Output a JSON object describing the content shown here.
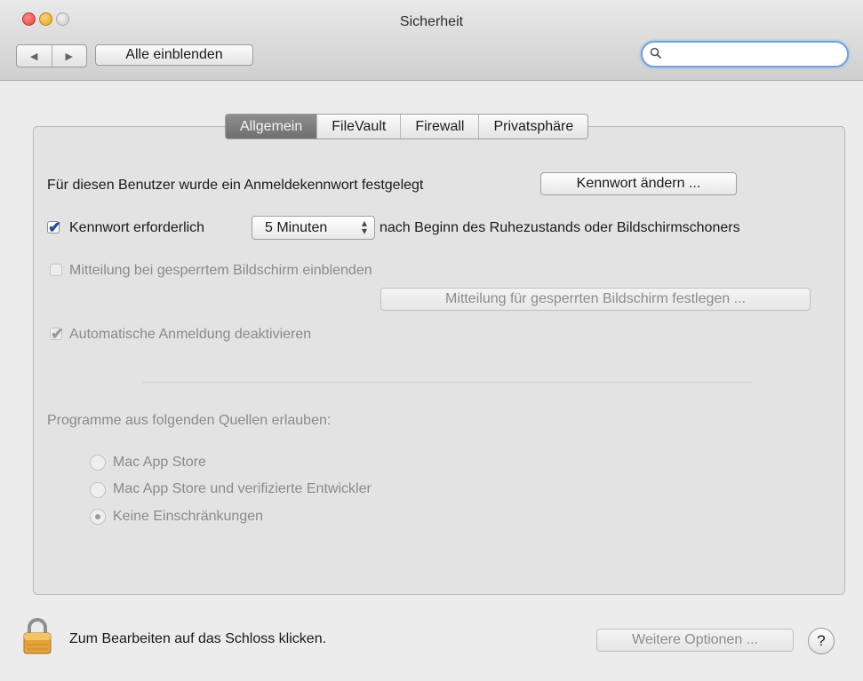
{
  "window": {
    "title": "Sicherheit"
  },
  "toolbar": {
    "back_icon": "◀",
    "forward_icon": "▶",
    "show_all_label": "Alle einblenden",
    "search_placeholder": "",
    "search_value": ""
  },
  "tabs": [
    {
      "label": "Allgemein",
      "active": true
    },
    {
      "label": "FileVault",
      "active": false
    },
    {
      "label": "Firewall",
      "active": false
    },
    {
      "label": "Privatsphäre",
      "active": false
    }
  ],
  "general": {
    "password_set_text": "Für diesen Benutzer wurde ein Anmeldekennwort festgelegt",
    "change_password_label": "Kennwort ändern ...",
    "require_password": {
      "label": "Kennwort erforderlich",
      "checked": true
    },
    "delay_select": {
      "value": "5 Minuten"
    },
    "after_sleep_text": "nach Beginn des Ruhezustands oder Bildschirmschoners",
    "show_message": {
      "label": "Mitteilung bei gesperrtem Bildschirm einblenden",
      "checked": false,
      "enabled": false
    },
    "set_message_label": "Mitteilung für gesperrten Bildschirm festlegen ...",
    "disable_auto_login": {
      "label": "Automatische Anmeldung deaktivieren",
      "checked": true,
      "enabled": false
    }
  },
  "gatekeeper": {
    "heading": "Programme aus folgenden Quellen erlauben:",
    "options": [
      {
        "label": "Mac App Store",
        "selected": false
      },
      {
        "label": "Mac App Store und verifizierte Entwickler",
        "selected": false
      },
      {
        "label": "Keine Einschränkungen",
        "selected": true
      }
    ]
  },
  "footer": {
    "lock_text": "Zum Bearbeiten auf das Schloss klicken.",
    "more_options_label": "Weitere Optionen ...",
    "help_label": "?"
  },
  "colors": {
    "window_bg": "#ececec",
    "active_tab": "#7a7a7a",
    "search_focus": "#6fa3e0",
    "disabled_text": "#8a8a8a"
  }
}
